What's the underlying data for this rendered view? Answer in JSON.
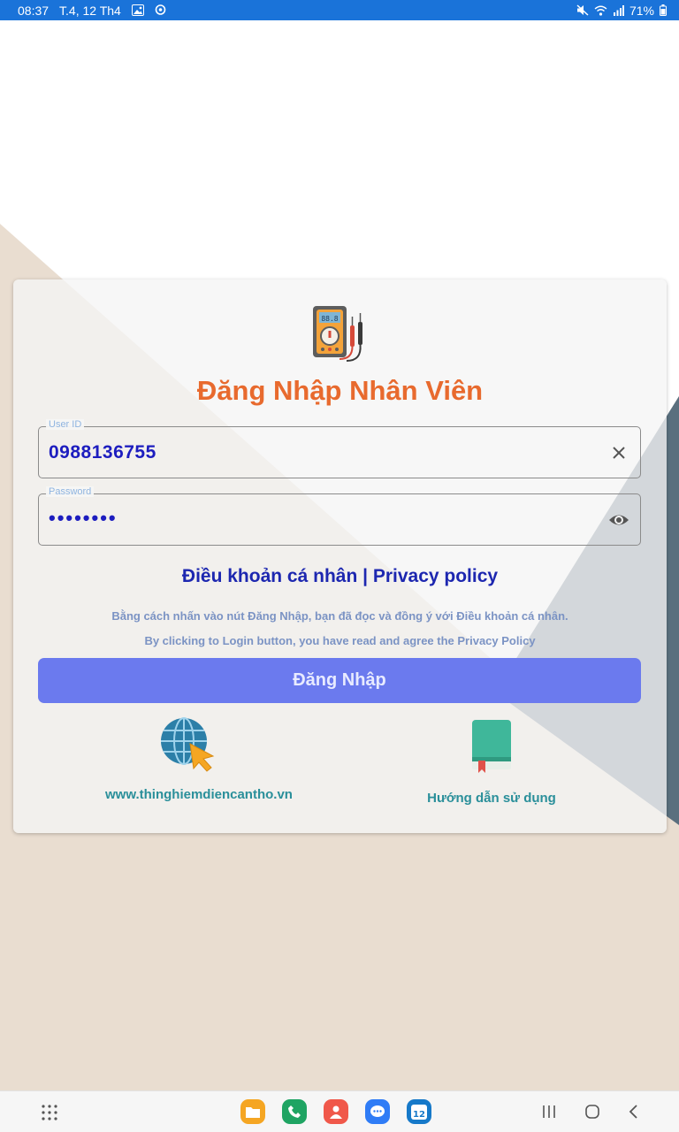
{
  "status_bar": {
    "time": "08:37",
    "date": "T.4, 12 Th4",
    "battery": "71%",
    "icons": [
      "image-icon",
      "location-icon",
      "mute-icon",
      "wifi-icon",
      "signal-icon",
      "battery-icon"
    ]
  },
  "login": {
    "title": "Đăng Nhập Nhân Viên",
    "user_id_label": "User ID",
    "user_id_value": "0988136755",
    "password_label": "Password",
    "password_value": "••••••••",
    "policy_link": "Điều khoản cá nhân | Privacy policy",
    "note_vi": "Bằng cách nhấn vào nút Đăng Nhập, bạn đã đọc và đồng ý với Điều khoản cá nhân.",
    "note_en": "By clicking to Login button, you have read and agree the Privacy Policy",
    "login_button": "Đăng Nhập",
    "website_link": "www.thinghiemdiencantho.vn",
    "guide_link": "Hướng dẫn sử dụng"
  },
  "dock": {
    "items": [
      "files-icon",
      "phone-icon",
      "contacts-icon",
      "messages-icon",
      "calendar-icon"
    ],
    "calendar_day": "12",
    "colors": [
      "#f5a623",
      "#1fa463",
      "#f0584a",
      "#2f7cf6",
      "#1679c9"
    ]
  },
  "colors": {
    "status_bar": "#1a73d9",
    "title": "#e86a2e",
    "input_text": "#1d1dbf",
    "button": "#6b7aee",
    "link": "#2a8f9a"
  }
}
